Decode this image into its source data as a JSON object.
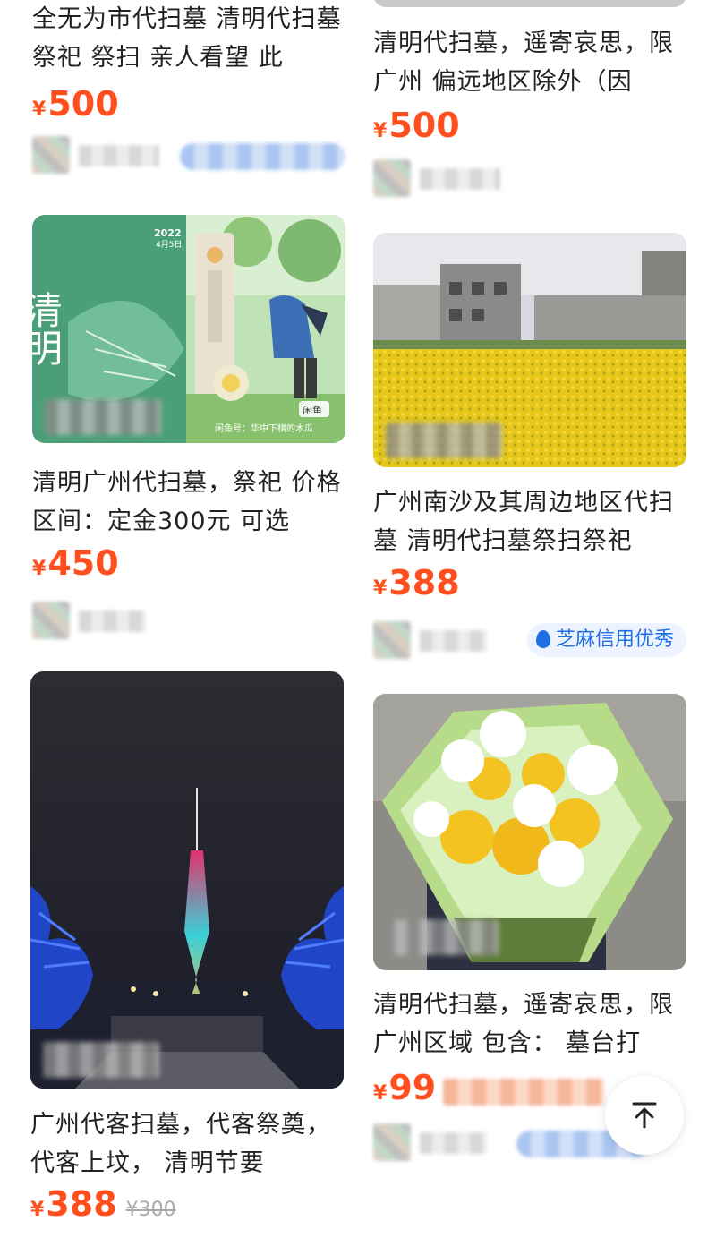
{
  "products": [
    {
      "title": "全无为市代扫墓 清明代扫墓 祭祀 祭扫 亲人看望 此",
      "price": "500",
      "currency": "¥"
    },
    {
      "title": "清明代扫墓，遥寄哀思，限广州 偏远地区除外（因",
      "price": "500",
      "currency": "¥"
    },
    {
      "title": "清明广州代扫墓，祭祀 价格区间：定金300元 可选",
      "price": "450",
      "currency": "¥",
      "image_text": {
        "poster_title": "清明",
        "date_year": "2022",
        "date_day": "4月5日",
        "watermark": "闲鱼号：华中下棋的木瓜",
        "badge": "闲鱼"
      }
    },
    {
      "title": "广州南沙及其周边地区代扫墓 清明代扫墓祭扫祭祀",
      "price": "388",
      "currency": "¥",
      "credit_badge": "芝麻信用优秀"
    },
    {
      "title": "广州代客扫墓，代客祭奠，代客上坟， 清明节要",
      "price": "388",
      "original_price": "¥300",
      "currency": "¥"
    },
    {
      "title": "清明代扫墓，遥寄哀思，限广州区域 包含： 墓台打",
      "price": "99",
      "currency": "¥"
    }
  ],
  "back_to_top": {
    "icon": "arrow-up-icon"
  },
  "colors": {
    "price": "#ff4f1f",
    "credit_blue": "#1f6fe5"
  }
}
